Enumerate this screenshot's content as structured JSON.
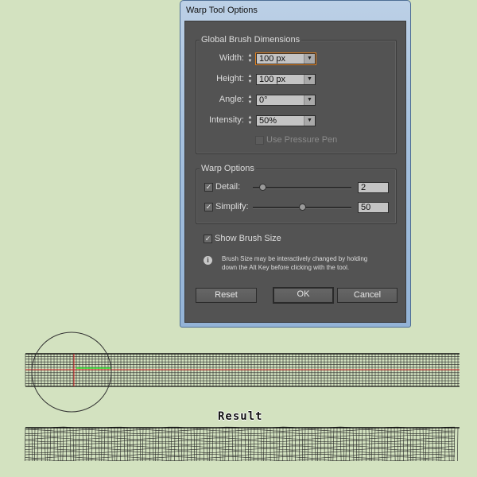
{
  "dialog": {
    "title": "Warp Tool Options",
    "global_group": {
      "legend": "Global Brush Dimensions",
      "fields": [
        {
          "label": "Width:",
          "value": "100 px"
        },
        {
          "label": "Height:",
          "value": "100 px"
        },
        {
          "label": "Angle:",
          "value": "0°"
        },
        {
          "label": "Intensity:",
          "value": "50%"
        }
      ],
      "pressure_pen": {
        "label": "Use Pressure Pen",
        "checked": false,
        "enabled": false
      }
    },
    "warp_group": {
      "legend": "Warp Options",
      "detail": {
        "label": "Detail:",
        "checked": true,
        "value": "2",
        "slider_fraction": 0.1
      },
      "simplify": {
        "label": "Simplify:",
        "checked": true,
        "value": "50",
        "slider_fraction": 0.5
      }
    },
    "show_brush_size": {
      "label": "Show Brush Size",
      "checked": true
    },
    "info": {
      "icon": "info-icon",
      "line1": "Brush Size may be interactively changed by holding",
      "line2": "down the Alt Key before clicking with the tool."
    },
    "buttons": {
      "reset": "Reset",
      "ok": "OK",
      "cancel": "Cancel"
    }
  },
  "illustration": {
    "result_label": "Result"
  },
  "colors": {
    "background": "#d3e2c0",
    "dialog_body": "#535353",
    "focus_accent": "#e0801e",
    "guide_red": "#e03030",
    "guide_green": "#30e030"
  }
}
